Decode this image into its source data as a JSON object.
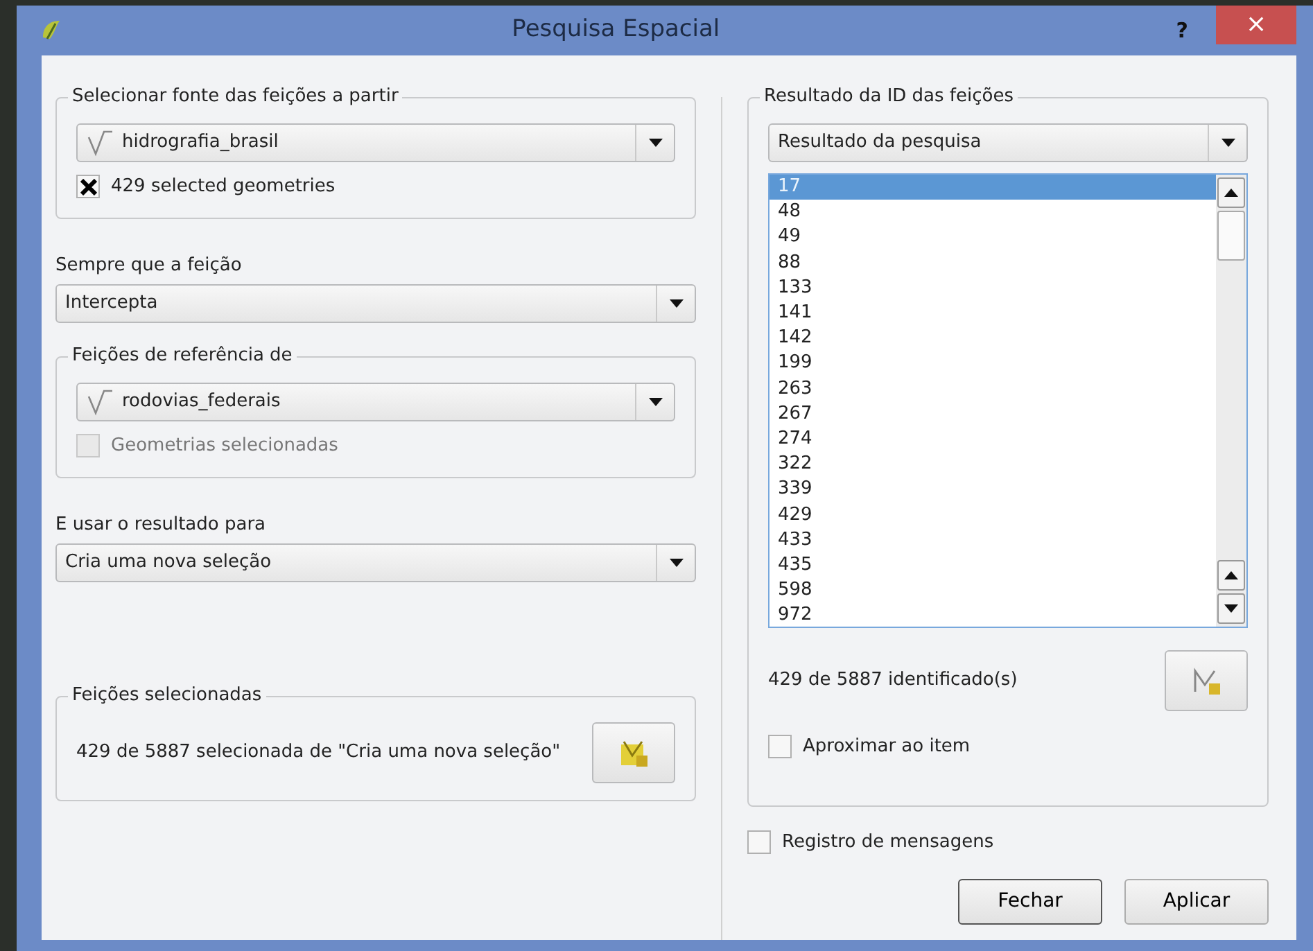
{
  "window": {
    "title": "Pesquisa Espacial",
    "help": "?",
    "close": "×"
  },
  "source": {
    "title": "Selecionar fonte das feições a partir",
    "layer": "hidrografia_brasil",
    "selected_only": {
      "label": "429 selected geometries",
      "checked": true,
      "disabled": false
    }
  },
  "predicate": {
    "label": "Sempre que a feição",
    "value": "Intercepta"
  },
  "reference": {
    "title": "Feições de referência de",
    "layer": "rodovias_federais",
    "selected_only": {
      "label": "Geometrias selecionadas",
      "checked": false,
      "disabled": true
    }
  },
  "use_result": {
    "label": "E usar o resultado para",
    "value": "Cria uma nova seleção"
  },
  "selected_features": {
    "title": "Feições selecionadas",
    "text": "429 de 5887 selecionada de \"Cria uma nova seleção\""
  },
  "results": {
    "title": "Resultado da ID das feições",
    "combo": "Resultado da pesquisa",
    "ids": [
      {
        "label": "17",
        "selected": true
      },
      {
        "label": "48",
        "selected": false
      },
      {
        "label": "49",
        "selected": false
      },
      {
        "label": "88",
        "selected": false
      },
      {
        "label": "133",
        "selected": false
      },
      {
        "label": "141",
        "selected": false
      },
      {
        "label": "142",
        "selected": false
      },
      {
        "label": "199",
        "selected": false
      },
      {
        "label": "263",
        "selected": false
      },
      {
        "label": "267",
        "selected": false
      },
      {
        "label": "274",
        "selected": false
      },
      {
        "label": "322",
        "selected": false
      },
      {
        "label": "339",
        "selected": false
      },
      {
        "label": "429",
        "selected": false
      },
      {
        "label": "433",
        "selected": false
      },
      {
        "label": "435",
        "selected": false
      },
      {
        "label": "598",
        "selected": false
      },
      {
        "label": "972",
        "selected": false
      }
    ],
    "count": "429 de 5887 identificado(s)",
    "zoom_to_item": {
      "label": "Aproximar ao item",
      "checked": false,
      "disabled": false
    }
  },
  "message_log": {
    "label": "Registro de mensagens",
    "checked": false,
    "disabled": false
  },
  "buttons": [
    "Fechar",
    "Aplicar"
  ]
}
